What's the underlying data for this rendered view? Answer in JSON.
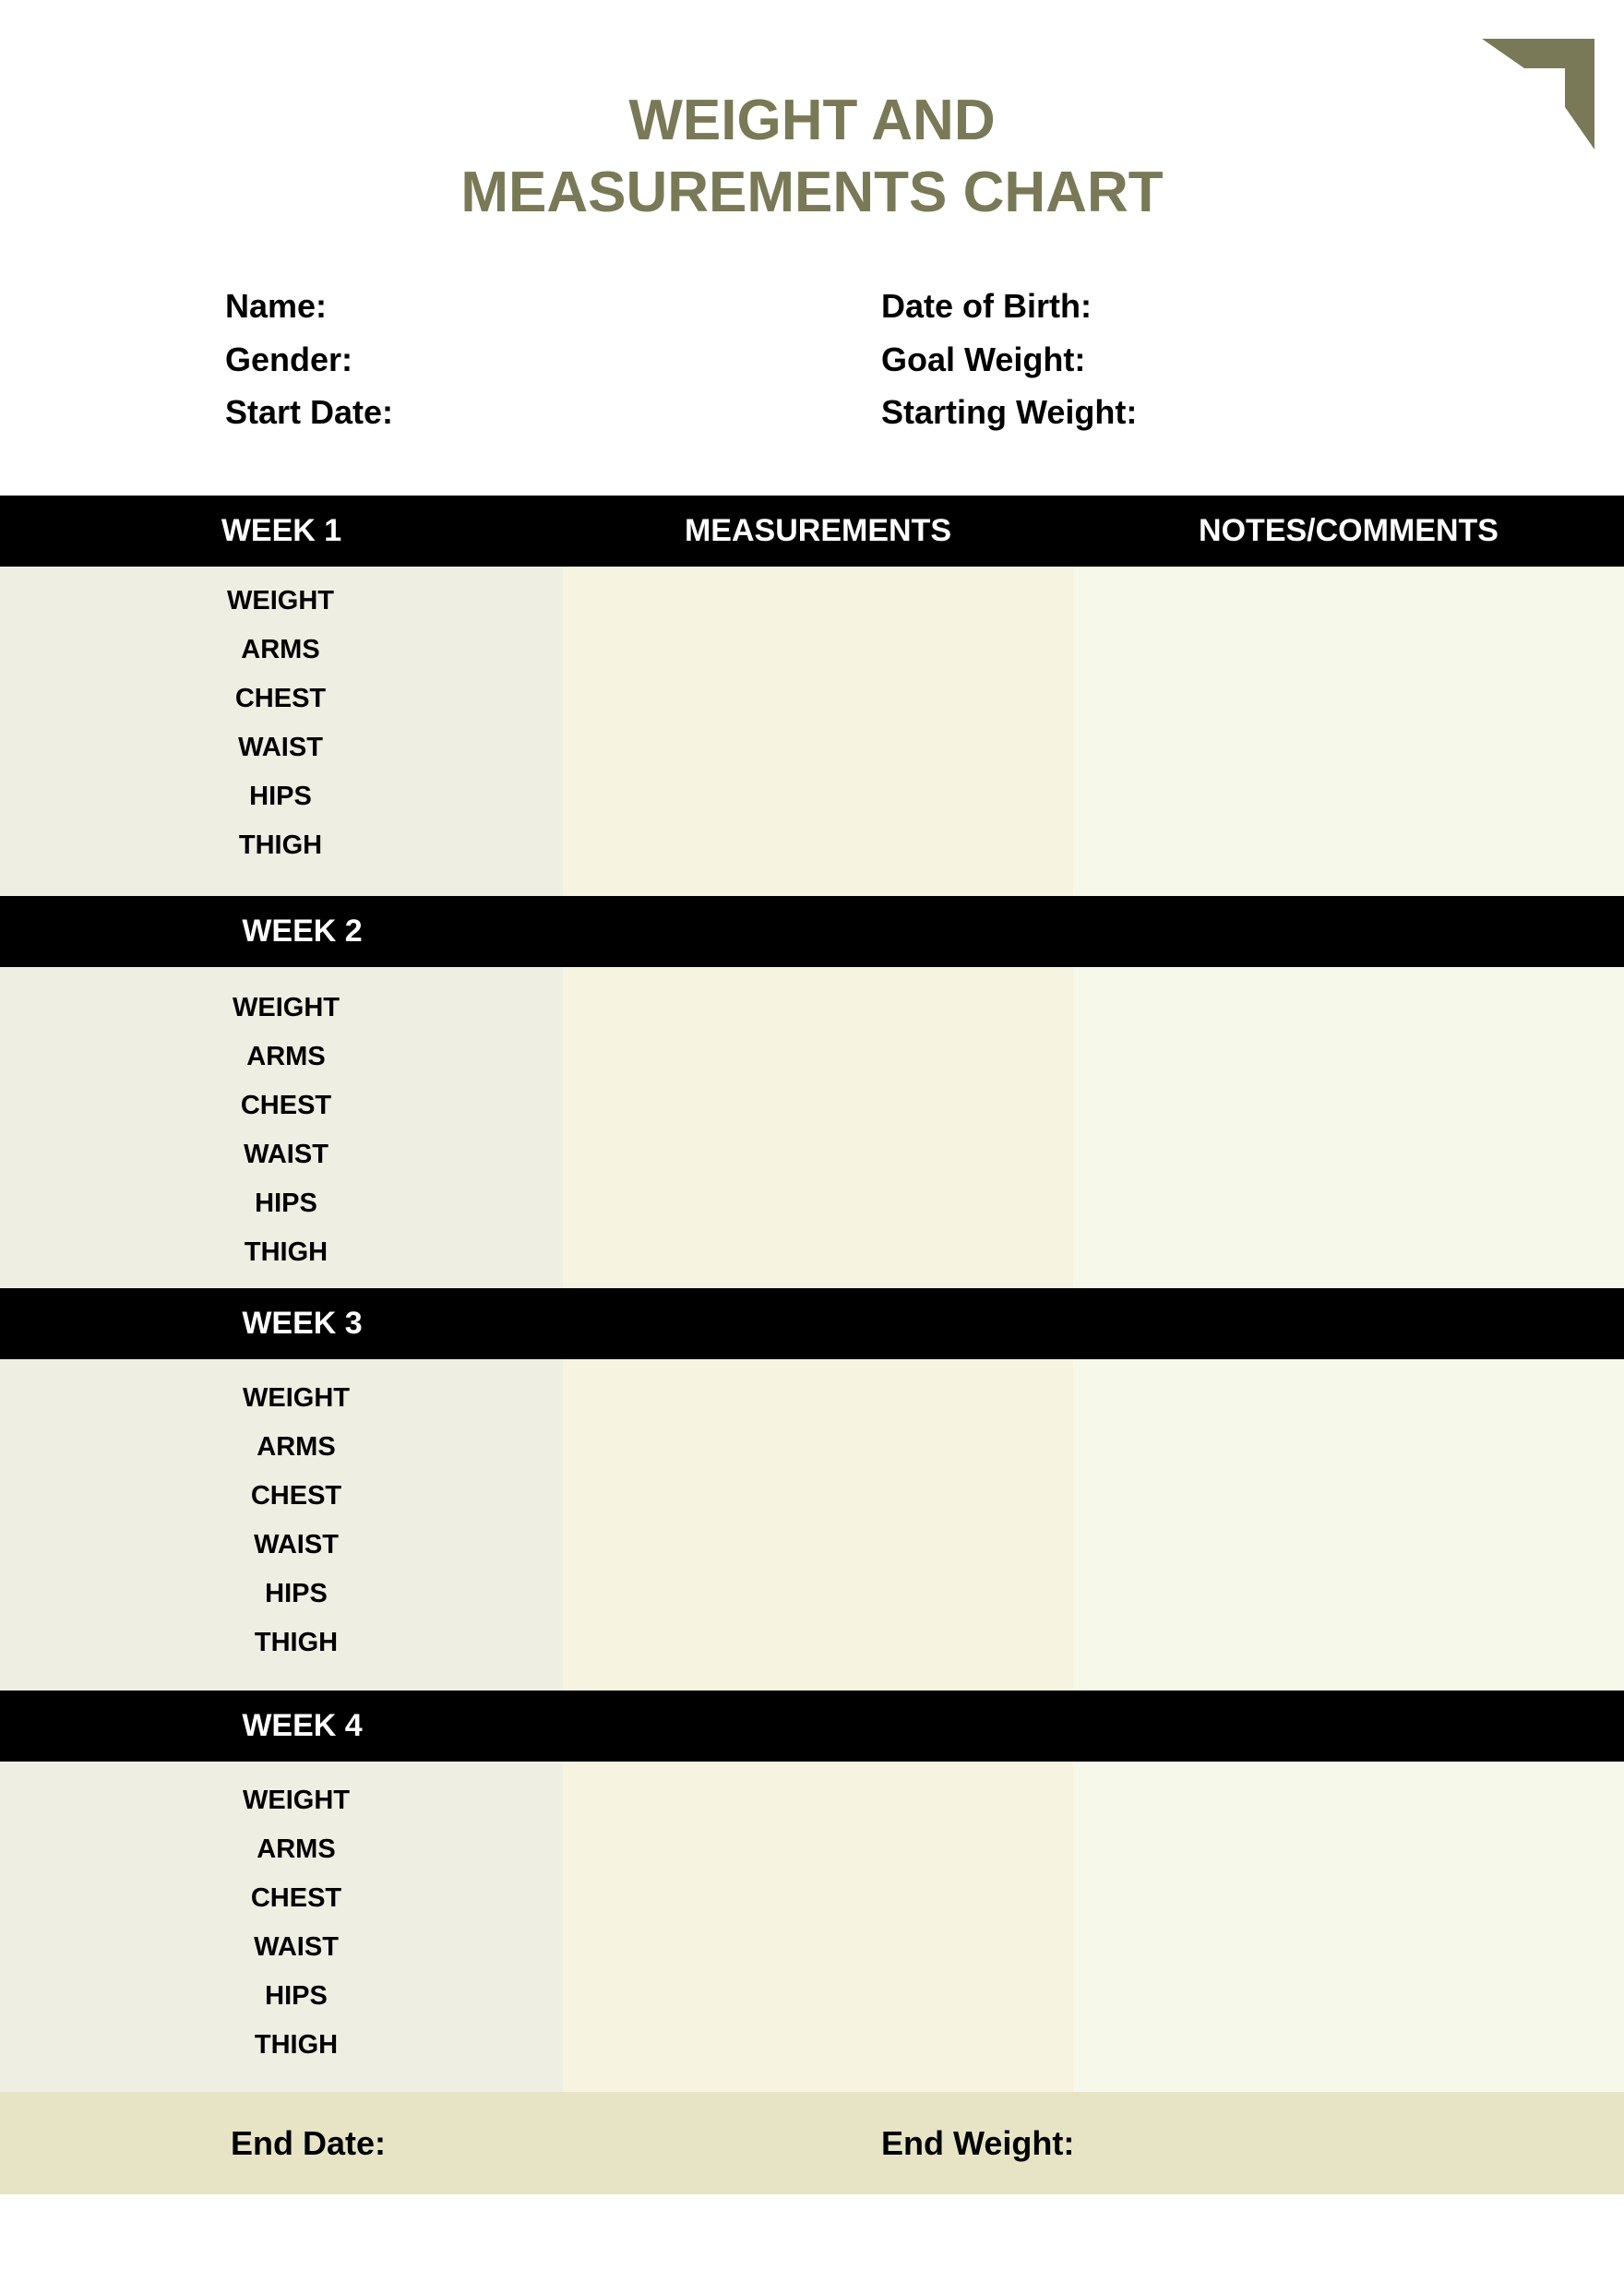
{
  "header": {
    "title_line1": "WEIGHT AND",
    "title_line2": "MEASUREMENTS CHART",
    "title_color": "#797957",
    "corner_icon": "corner-bracket-icon"
  },
  "info": {
    "left": [
      "Name:",
      "Gender:",
      "Start Date:"
    ],
    "right": [
      "Date of Birth:",
      "Goal Weight:",
      "Starting Weight:"
    ]
  },
  "table": {
    "columns": [
      "WEEK 1",
      "MEASUREMENTS",
      "NOTES/COMMENTS"
    ],
    "weeks": [
      {
        "label": "WEEK 1",
        "rows": [
          "WEIGHT",
          "ARMS",
          "CHEST",
          "WAIST",
          "HIPS",
          "THIGH"
        ]
      },
      {
        "label": "WEEK 2",
        "rows": [
          "WEIGHT",
          "ARMS",
          "CHEST",
          "WAIST",
          "HIPS",
          "THIGH"
        ]
      },
      {
        "label": "WEEK 3",
        "rows": [
          "WEIGHT",
          "ARMS",
          "CHEST",
          "WAIST",
          "HIPS",
          "THIGH"
        ]
      },
      {
        "label": "WEEK 4",
        "rows": [
          "WEIGHT",
          "ARMS",
          "CHEST",
          "WAIST",
          "HIPS",
          "THIGH"
        ]
      }
    ],
    "colors": {
      "header_bar": "#000000",
      "label_column": "#EEEFE2",
      "measurements_column": "#F6F4E0",
      "notes_column": "#F6F9EA"
    }
  },
  "footer": {
    "end_date_label": "End Date:",
    "end_weight_label": "End Weight:",
    "band_color": "#E7E4C5"
  }
}
